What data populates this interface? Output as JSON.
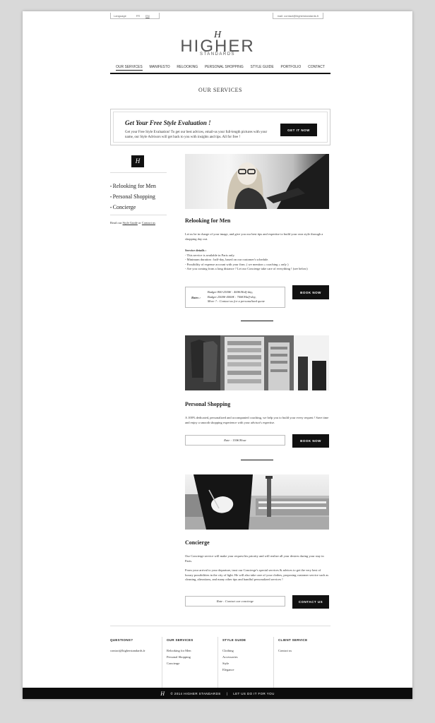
{
  "topbar": {
    "language_label": "Language",
    "languages": [
      "FR",
      "EN"
    ],
    "email": "mail: contact@higherstandards.fr"
  },
  "logo": {
    "monogram": "H",
    "brand": "HIGHER",
    "tagline": "STANDARDS"
  },
  "nav": {
    "items": [
      "OUR SERVICES",
      "MANIFESTO",
      "RELOOKING",
      "PERSONAL SHOPPING",
      "STYLE GUIDE",
      "PORTFOLIO",
      "CONTACT"
    ]
  },
  "page_title": "OUR SERVICES",
  "promo": {
    "title": "Get Your Free Style Evaluation !",
    "text": "Get your Free Style Evaluation! To get our best advices, email-us your full-length pictures with your name, our Style Advisors will get back to you with insights and tips. All for free !",
    "button": "GET IT NOW"
  },
  "sidebar": {
    "items": [
      "Relooking for Men",
      "Personal Shopping",
      "Concierge"
    ],
    "foot_prefix": "Read our",
    "foot_link1": "Style Guide",
    "foot_mid": "or",
    "foot_link2": "Contact us"
  },
  "sections": {
    "relooking": {
      "title": "Relooking for Men",
      "intro": "Let us be in charge of your image, and give you our best tips and expertise to build your own style through a shopping day out.",
      "details_label": "Service details :",
      "details": [
        "This service is available in Paris only.",
        "Minimum duration : half-day, based on our customer's schedule.",
        "Possibility of expense account with your firm. ( we mention « coaching » only )",
        "Are you coming from a long distance ? Let our Concierge take care of everything ! (see below)"
      ],
      "rates_label": "Rates :",
      "rates_lines": [
        "Budget 800-2500€ : 400€/Half-day,",
        "Budget 2500€-4000€ : 700€/Half-day,",
        "More ? : Contact us for a personalized quote"
      ],
      "button": "BOOK NOW"
    },
    "shopping": {
      "title": "Personal Shopping",
      "intro": "A 100% dedicated, personalized and accompanied coaching, we help you to build your every request ! Save time and enjoy a smooth shopping experience with your advisor's expertise.",
      "rate": "Rate : 150€/Hour",
      "button": "BOOK NOW"
    },
    "concierge": {
      "title": "Concierge",
      "p1": "Our Concierge service will make your request his priority and will realize all your desires during your stay in Paris.",
      "p2": "From your arrival to your departure, trust our Concierge's special services & advices to get the very best of luxury possibilities in the city of light. He will also take care of your clothes, proposing customer service such as cleaning, alterations, and many other tips and handful personalized services !",
      "rate": "Rate : Contact our concierge",
      "button": "CONTACT US"
    }
  },
  "footer": {
    "questions": {
      "title": "QUESTIONS?",
      "email": "contact@higherstandards.fr"
    },
    "services": {
      "title": "OUR SERVICES",
      "items": [
        "Relooking for Men",
        "Personal Shopping",
        "Concierge"
      ]
    },
    "style": {
      "title": "STYLE GUIDE",
      "items": [
        "Clothing",
        "Accessories",
        "Style",
        "Elegance"
      ]
    },
    "client": {
      "title": "CLIENT SERVICE",
      "items": [
        "Contact us"
      ]
    }
  },
  "bottombar": {
    "copyright": "© 2014 HIGHER STANDARDS",
    "sep": "|",
    "slogan": "LET US DO IT FOR YOU"
  }
}
